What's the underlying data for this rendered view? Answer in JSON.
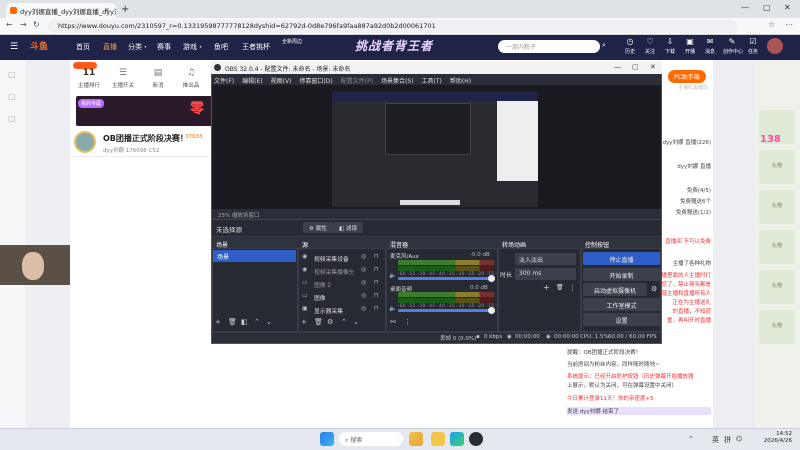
{
  "browser": {
    "tab_title": "dyy刘娜直播_dyy刘娜直播_dyy刘",
    "url": "https://www.douyu.com/2310597_r=0.13319598777778128dyshid=62792d-0d8e796fa9faa887a92d0b2d00061701",
    "new_tab_glyph": "+",
    "close_glyph": "×"
  },
  "douyu": {
    "logo": "斗鱼",
    "nav": [
      "首页",
      "直播",
      "分类・",
      "赛事",
      "游戏・",
      "鱼吧",
      "王者挑杯"
    ],
    "promo_text": "挑战者背王者",
    "promo_sub": "全新周边",
    "search_placeholder": "一周内粉子",
    "top_icons": [
      "历史",
      "关注",
      "下载",
      "开播",
      "消息",
      "创作中心",
      "任务"
    ]
  },
  "left_categories": [
    {
      "label": "11",
      "sub": "主播排行"
    },
    {
      "label": "主播开关",
      "sub": ""
    },
    {
      "label": "新消",
      "sub": ""
    },
    {
      "label": "推出品",
      "sub": ""
    }
  ],
  "banner": {
    "tag": "我的专属",
    "big": "零"
  },
  "room": {
    "title": "OB团播正式阶段决赛！",
    "hot": "37033",
    "meta": "dyy刘娜   176098   C52",
    "hot_tag": "8"
  },
  "right_panel": {
    "pc_button": "PC助手端",
    "sub": "主播红黑榜白",
    "lines": [
      "dyy刘娜 直播(226)",
      "dyy刘娜 直播",
      "免费(4/5)",
      "免费赠送6个",
      "免费赠送(1/2)",
      "直播间 不可以免费",
      "主播了各种礼物",
      "直播里面的人主播时打",
      "送给您了，禁止辱骂都是",
      "和谐主播和直播所有人",
      "正在为主播送礼",
      "的直播，不知道",
      "重，再叫开时直播"
    ]
  },
  "chat": [
    {
      "text": "提醒：OB团播正式阶段决赛！",
      "red": false
    },
    {
      "text": "当前房间为粉丝内容，同样随时随地~",
      "red": false
    },
    {
      "text": "系统提示：已经开启防护按钮（历史弹幕开始播放器",
      "red": true
    },
    {
      "text": "上展示，默认为关闭，可在弹幕设置中关闭）",
      "red": false
    },
    {
      "text": "今日累计登录11天！你的亲密度+5",
      "red": true
    },
    {
      "text": "发送 dyy刘娜 结束了",
      "red": false
    }
  ],
  "sidebar_gifts": [
    "138",
    "礼物",
    "礼物",
    "礼物",
    "礼物",
    "礼物"
  ],
  "obs": {
    "title": "OBS 32.0.4 - 配置文件: 未命名 - 场景: 未命名",
    "menu": [
      "文件(F)",
      "编辑(E)",
      "视图(V)",
      "停靠窗口(D)",
      "配置文件(P)",
      "场景集合(S)",
      "工具(T)",
      "帮助(H)"
    ],
    "zoom": "25%",
    "zoom_mode": "缩放到窗口",
    "no_scene": "未选择源",
    "props_btn": "属性",
    "filters_btn": "滤镜",
    "docks": {
      "scenes": "场景",
      "sources": "源",
      "mixer": "混音器",
      "transitions": "转场动画",
      "controls": "控制按钮"
    },
    "scenes": [
      "场景"
    ],
    "sources": [
      "视频采集设备",
      "视频采集摄像头",
      "图像 2",
      "图像",
      "显示器采集"
    ],
    "mixer": [
      {
        "name": "麦克风/Aux",
        "db": "-0.0 dB"
      },
      {
        "name": "桌面音频",
        "db": "0.0 dB"
      }
    ],
    "mixer_scale": "-60 -55 -50 -45 -40 -35 -30 -25 -20 -15 -10 -5 0",
    "transition": {
      "type": "淡入淡出",
      "dur_label": "时长",
      "duration": "300 ms"
    },
    "controls": [
      "停止直播",
      "开始录制",
      "启动虚拟摄像机",
      "工作室模式",
      "设置"
    ],
    "status": {
      "dropped": "丢帧 0 (0.0%)",
      "kbps": "0 kbps",
      "time1": "00:00:00",
      "time2": "00:00:00",
      "cpu": "CPU: 1.5%",
      "fps": "60.00 / 60.00 FPS"
    }
  },
  "taskbar": {
    "search": "搜索",
    "lang": "英",
    "lang2": "拼",
    "time": "14:52",
    "date": "2026/4/26"
  }
}
